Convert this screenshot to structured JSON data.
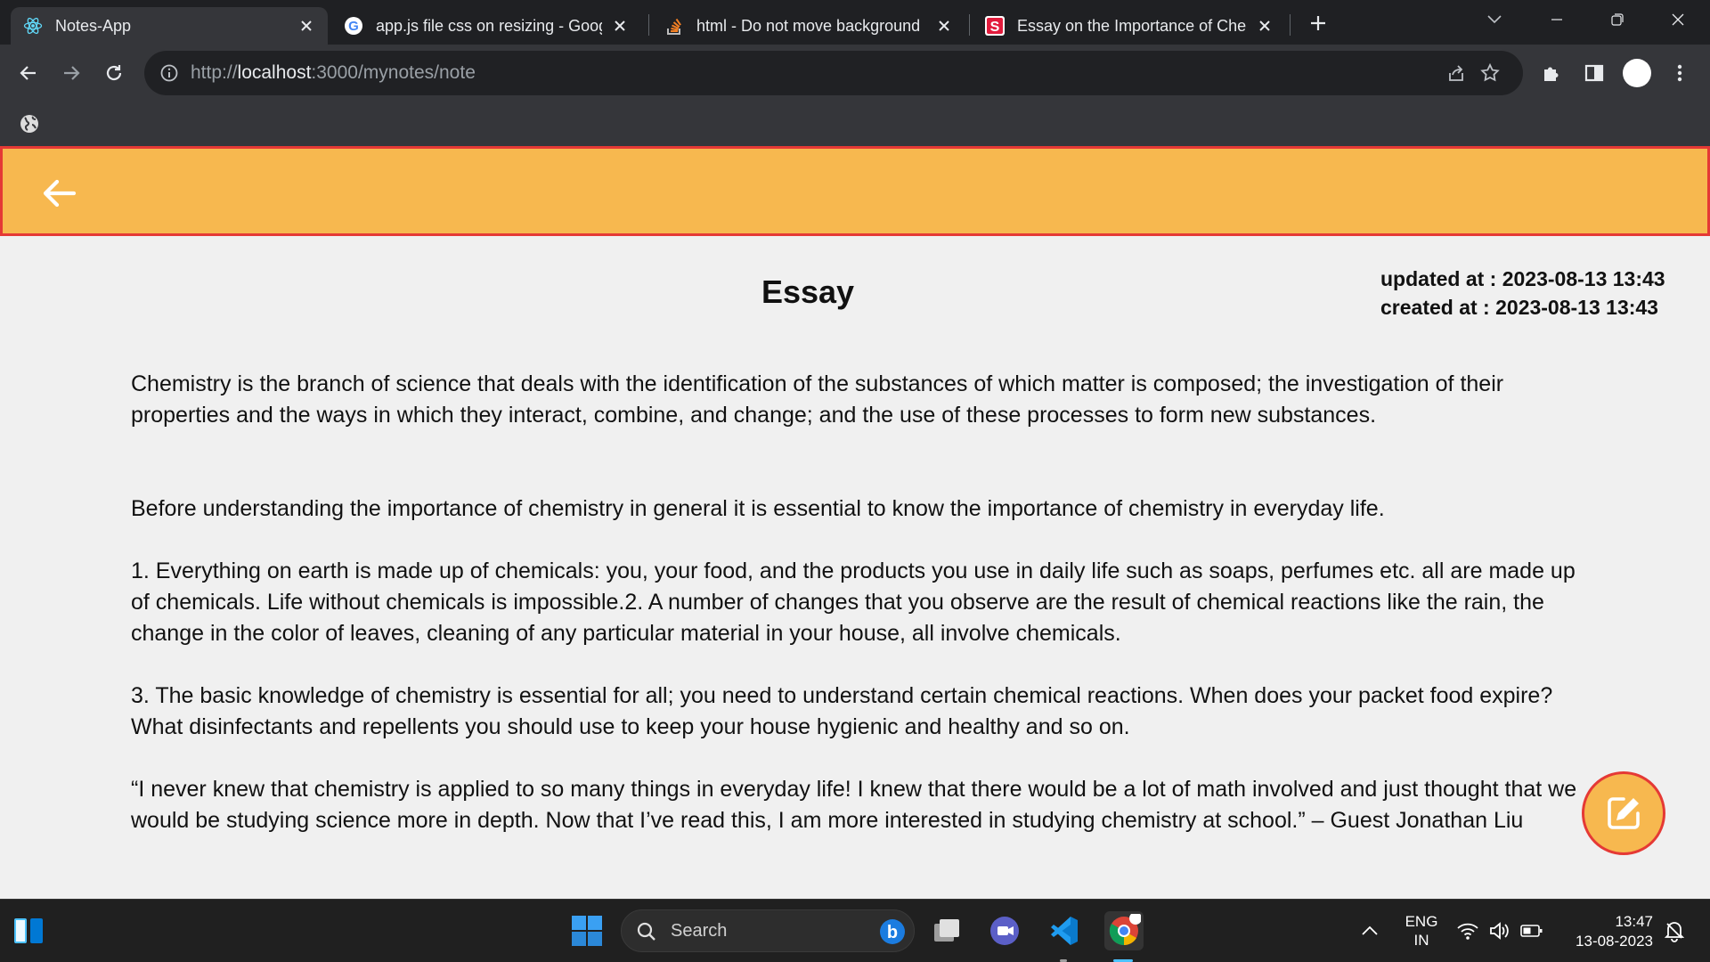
{
  "browser": {
    "tabs": [
      {
        "title": "Notes-App",
        "icon": "react-icon",
        "active": true
      },
      {
        "title": "app.js file css on resizing - Googl",
        "icon": "google-icon",
        "active": false
      },
      {
        "title": "html - Do not move background",
        "icon": "stackoverflow-icon",
        "active": false
      },
      {
        "title": "Essay on the Importance of Chem",
        "icon": "s-brand-icon",
        "active": false
      }
    ],
    "url_prefix": "http://",
    "url_host": "localhost",
    "url_rest": ":3000/mynotes/note"
  },
  "note": {
    "title": "Essay",
    "updated_label": "updated at : 2023-08-13 13:43",
    "created_label": "created at : 2023-08-13 13:43",
    "paragraphs": [
      "Chemistry is the branch of science that deals with the identification of the substances of which matter is composed; the investigation of their properties and the ways in which they interact, combine, and change; and the use of these processes to form new substances.",
      "Before understanding the importance of chemistry in general it is essential to know the importance of chemistry in everyday life.",
      "1. Everything on earth is made up of chemicals: you, your food, and the products you use in daily life such as soaps, perfumes etc. all are made up of chemicals. Life without chemicals is impossible.2. A number of changes that you observe are the result of chemical reactions like the rain, the change in the color of leaves, cleaning of any particular material in your house, all involve chemicals.",
      "3. The basic knowledge of chemistry is essential for all; you need to understand certain chemical reactions. When does your packet food expire? What disinfectants and repellents you should use to keep your house hygienic and healthy and so on.",
      "“I never knew that chemistry is applied to so many things in everyday life! I knew that there would be a lot of math involved and just thought that we would be studying science more in depth. Now that I’ve read this, I am more interested in studying chemistry at school.” – Guest Jonathan Liu"
    ]
  },
  "colors": {
    "accent": "#f7b84f",
    "border": "#e53935"
  },
  "taskbar": {
    "search_label": "Search",
    "lang_line1": "ENG",
    "lang_line2": "IN",
    "time": "13:47",
    "date": "13-08-2023"
  }
}
